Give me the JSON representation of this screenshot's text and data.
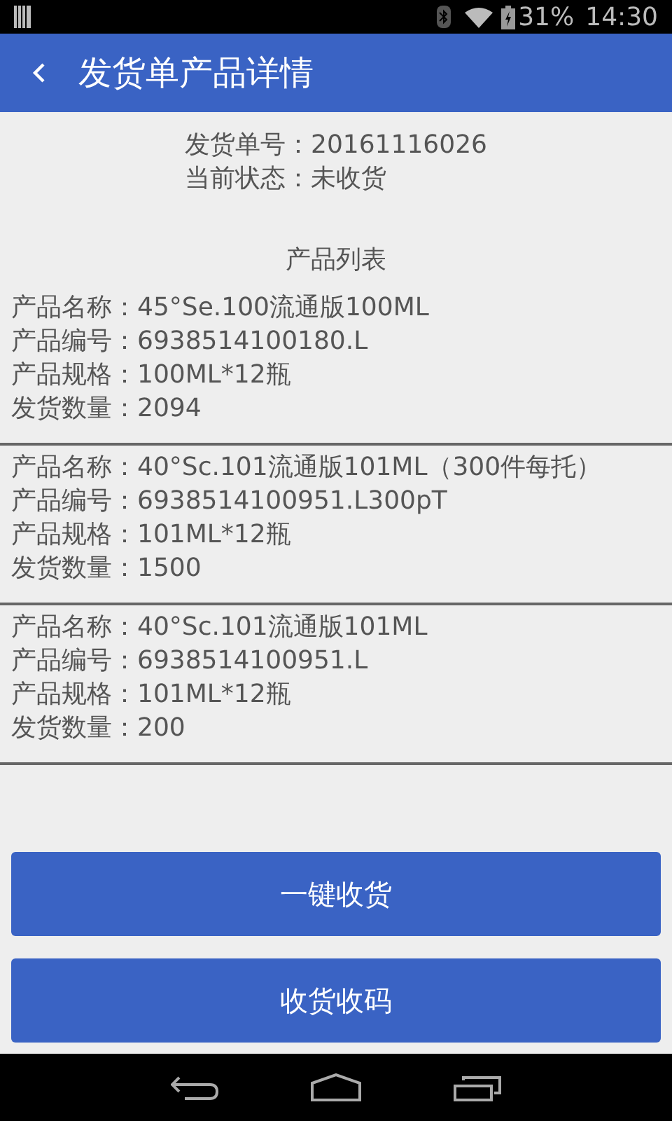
{
  "status_bar": {
    "battery": "31%",
    "time": "14:30"
  },
  "app_bar": {
    "title": "发货单产品详情"
  },
  "order": {
    "number": "发货单号：20161116026",
    "status": "当前状态：未收货"
  },
  "list_title": "产品列表",
  "products": [
    {
      "lines": [
        "产品名称：45°Se.100流通版100ML",
        "产品编号：6938514100180.L",
        "产品规格：100ML*12瓶",
        "发货数量：2094"
      ]
    },
    {
      "lines": [
        "产品名称：40°Sc.101流通版101ML（300件每托）",
        "产品编号：6938514100951.L300pT",
        "产品规格：101ML*12瓶",
        "发货数量：1500"
      ]
    },
    {
      "lines": [
        "产品名称：40°Sc.101流通版101ML",
        "产品编号：6938514100951.L",
        "产品规格：101ML*12瓶",
        "发货数量：200"
      ]
    }
  ],
  "buttons": [
    "一键收货",
    "收货收码"
  ]
}
